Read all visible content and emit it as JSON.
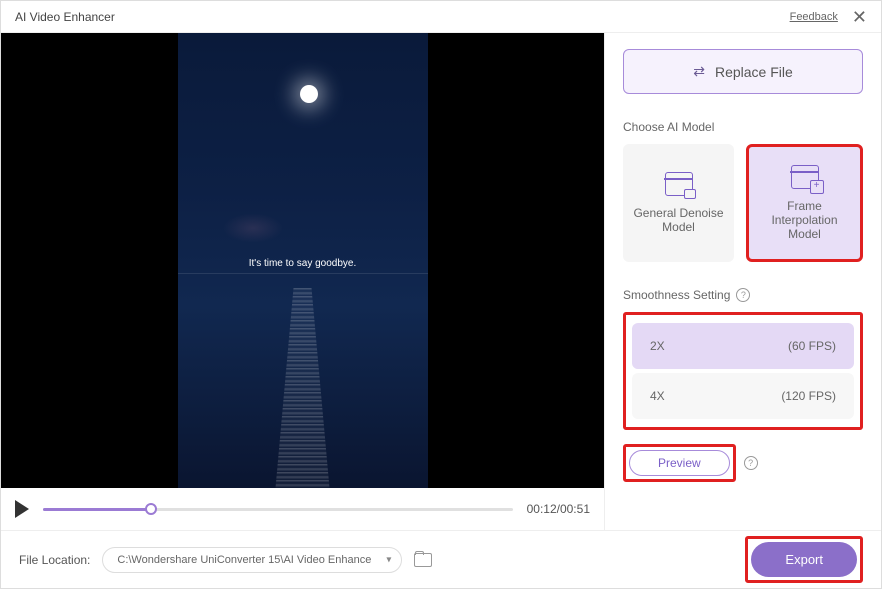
{
  "title": "AI Video Enhancer",
  "feedback": "Feedback",
  "replace_label": "Replace File",
  "section_models": "Choose AI Model",
  "models": {
    "denoise": "General Denoise Model",
    "interp": "Frame Interpolation Model"
  },
  "section_smooth": "Smoothness Setting",
  "smooth": [
    {
      "mult": "2X",
      "fps": "(60 FPS)"
    },
    {
      "mult": "4X",
      "fps": "(120 FPS)"
    }
  ],
  "preview": "Preview",
  "video": {
    "caption": "It's time to say goodbye.",
    "time": "00:12/00:51"
  },
  "location": {
    "label": "File Location:",
    "path": "C:\\Wondershare UniConverter 15\\AI Video Enhance"
  },
  "export": "Export",
  "colors": {
    "accent": "#8b6fc9",
    "highlight": "#e02020"
  }
}
